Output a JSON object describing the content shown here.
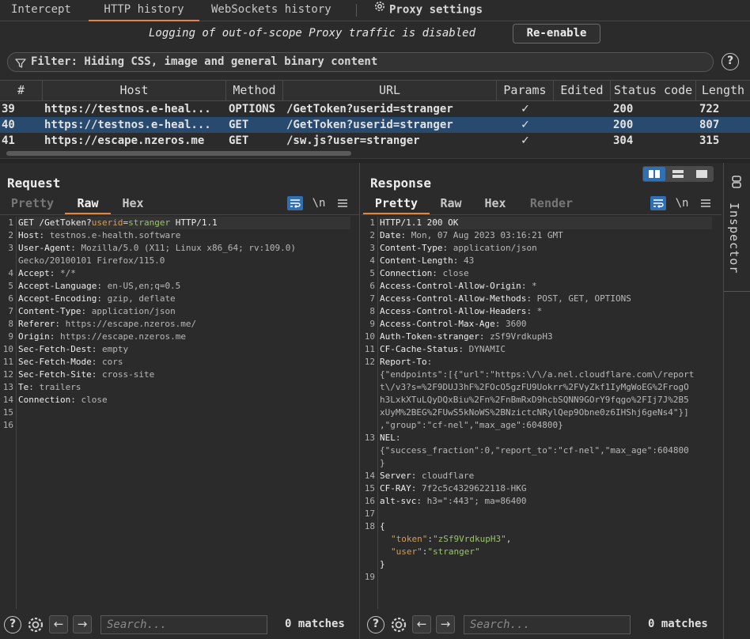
{
  "top_tabs": {
    "intercept": "Intercept",
    "http_history": "HTTP history",
    "websockets_history": "WebSockets history",
    "proxy_settings": "Proxy settings"
  },
  "banner": {
    "text": "Logging of out-of-scope Proxy traffic is disabled",
    "button": "Re-enable"
  },
  "filter": {
    "text": "Filter: Hiding CSS, image and general binary content",
    "help": "?"
  },
  "table": {
    "headers": {
      "num": "#",
      "host": "Host",
      "method": "Method",
      "url": "URL",
      "params": "Params",
      "edited": "Edited",
      "status": "Status code",
      "length": "Length"
    },
    "rows": [
      {
        "num": "39",
        "host": "https://testnos.e-heal...",
        "method": "OPTIONS",
        "url": "/GetToken?userid=stranger",
        "params": "✓",
        "edited": "",
        "status": "200",
        "length": "722"
      },
      {
        "num": "40",
        "host": "https://testnos.e-heal...",
        "method": "GET",
        "url": "/GetToken?userid=stranger",
        "params": "✓",
        "edited": "",
        "status": "200",
        "length": "807"
      },
      {
        "num": "41",
        "host": "https://escape.nzeros.me",
        "method": "GET",
        "url": "/sw.js?user=stranger",
        "params": "✓",
        "edited": "",
        "status": "304",
        "length": "315"
      }
    ]
  },
  "request": {
    "title": "Request",
    "tabs": {
      "pretty": "Pretty",
      "raw": "Raw",
      "hex": "Hex"
    },
    "newline_toggle": "\\n",
    "line_numbers": [
      "1",
      "2",
      "3",
      "",
      "4",
      "5",
      "6",
      "7",
      "8",
      "9",
      "10",
      "11",
      "12",
      "13",
      "14",
      "15",
      "16"
    ],
    "line1": {
      "method": "GET /GetToken?",
      "param_key": "userid",
      "eq": "=",
      "param_val": "stranger",
      "proto": " HTTP/1.1"
    },
    "headers": [
      {
        "k": "Host",
        "v": " testnos.e-health.software"
      },
      {
        "k": "User-Agent",
        "v": " Mozilla/5.0 (X11; Linux x86_64; rv:109.0)"
      },
      {
        "k": "",
        "v": "Gecko/20100101 Firefox/115.0"
      },
      {
        "k": "Accept",
        "v": " */*"
      },
      {
        "k": "Accept-Language",
        "v": " en-US,en;q=0.5"
      },
      {
        "k": "Accept-Encoding",
        "v": " gzip, deflate"
      },
      {
        "k": "Content-Type",
        "v": " application/json"
      },
      {
        "k": "Referer",
        "v": " https://escape.nzeros.me/"
      },
      {
        "k": "Origin",
        "v": " https://escape.nzeros.me"
      },
      {
        "k": "Sec-Fetch-Dest",
        "v": " empty"
      },
      {
        "k": "Sec-Fetch-Mode",
        "v": " cors"
      },
      {
        "k": "Sec-Fetch-Site",
        "v": " cross-site"
      },
      {
        "k": "Te",
        "v": " trailers"
      },
      {
        "k": "Connection",
        "v": " close"
      }
    ],
    "search_placeholder": "Search...",
    "matches": "0 matches"
  },
  "response": {
    "title": "Response",
    "tabs": {
      "pretty": "Pretty",
      "raw": "Raw",
      "hex": "Hex",
      "render": "Render"
    },
    "newline_toggle": "\\n",
    "status_line": "HTTP/1.1 200 OK",
    "line_numbers": [
      "1",
      "2",
      "3",
      "4",
      "5",
      "6",
      "7",
      "8",
      "9",
      "10",
      "11",
      "12",
      "",
      "",
      "",
      "",
      "13",
      "",
      "14",
      "15",
      "16",
      "17",
      "18",
      "",
      "",
      "",
      "19"
    ],
    "headers": [
      {
        "k": "Date",
        "v": " Mon, 07 Aug 2023 03:16:21 GMT"
      },
      {
        "k": "Content-Type",
        "v": " application/json"
      },
      {
        "k": "Content-Length",
        "v": " 43"
      },
      {
        "k": "Connection",
        "v": " close"
      },
      {
        "k": "Access-Control-Allow-Origin",
        "v": " *"
      },
      {
        "k": "Access-Control-Allow-Methods",
        "v": " POST, GET, OPTIONS"
      },
      {
        "k": "Access-Control-Allow-Headers",
        "v": " *"
      },
      {
        "k": "Access-Control-Max-Age",
        "v": " 3600"
      },
      {
        "k": "Auth-Token-stranger",
        "v": " zSf9VrdkupH3"
      },
      {
        "k": "CF-Cache-Status",
        "v": " DYNAMIC"
      },
      {
        "k": "Report-To",
        "v": ":"
      }
    ],
    "report_to_value": [
      "{\"endpoints\":[{\"url\":\"https:\\/\\/a.nel.cloudflare.com\\/report",
      "t\\/v3?s=%2F9DUJ3hF%2FOcO5gzFU9Uokrr%2FVyZkf1IyMgWoEG%2FrogO",
      "h3LxkXTuLQyDQxBiu%2Fn%2FnBmRxD9hcbSQNN9GOrY9fqgo%2FIj7J%2B5",
      "xUyM%2BEG%2FUwS5kNoWS%2BNzictcNRylQep9Obne0z6IHShj6geNs4\"}]",
      ",\"group\":\"cf-nel\",\"max_age\":604800}"
    ],
    "nel_key": "NEL",
    "nel_value": [
      "{\"success_fraction\":0,\"report_to\":\"cf-nel\",\"max_age\":604800",
      "}"
    ],
    "headers_after": [
      {
        "k": "Server",
        "v": " cloudflare"
      },
      {
        "k": "CF-RAY",
        "v": " 7f2c5c4329622118-HKG"
      },
      {
        "k": "alt-svc",
        "v": " h3=\":443\"; ma=86400"
      }
    ],
    "body": {
      "open": "{",
      "token_key": "\"token\"",
      "token_val": "\"zSf9VrdkupH3\"",
      "user_key": "\"user\"",
      "user_val": "\"stranger\"",
      "close": "}"
    },
    "search_placeholder": "Search...",
    "matches": "0 matches"
  },
  "inspector": {
    "label": "Inspector"
  },
  "colors": {
    "accent": "#e8833a",
    "selection": "#274a6e",
    "blue_toggle": "#2f6fb3"
  }
}
